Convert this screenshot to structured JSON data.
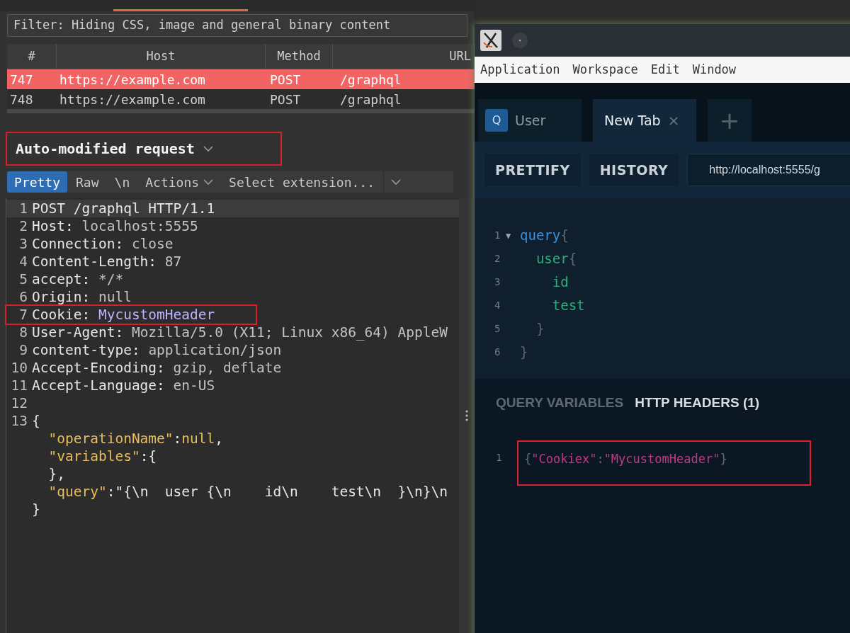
{
  "burp": {
    "filter": "Filter: Hiding CSS, image and general binary content",
    "table": {
      "columns": [
        "#",
        "Host",
        "Method",
        "URL"
      ],
      "rows": [
        {
          "cells": [
            "747",
            "https://example.com",
            "POST",
            "/graphql"
          ],
          "selected": true
        },
        {
          "cells": [
            "748",
            "https://example.com",
            "POST",
            "/graphql"
          ],
          "selected": false
        }
      ]
    },
    "request_title": "Auto-modified request",
    "request_title_highlighted": true,
    "toolbar": [
      {
        "label": "Pretty",
        "kind": "tab",
        "selected": true
      },
      {
        "label": "Raw",
        "kind": "tab",
        "selected": false
      },
      {
        "label": "\\n",
        "kind": "tab",
        "selected": false
      },
      {
        "label": "Actions",
        "kind": "menu",
        "selected": false
      },
      {
        "label": "Select extension...",
        "kind": "select",
        "selected": false
      }
    ],
    "editor": [
      {
        "number": "1",
        "current": true,
        "highlighted": false,
        "segments": [
          {
            "text": "POST /graphql HTTP/1.1",
            "kind": "name"
          }
        ]
      },
      {
        "number": "2",
        "current": false,
        "highlighted": false,
        "segments": [
          {
            "text": "Host: ",
            "kind": "name"
          },
          {
            "text": "localhost:5555",
            "kind": "value"
          }
        ]
      },
      {
        "number": "3",
        "current": false,
        "highlighted": false,
        "segments": [
          {
            "text": "Connection: ",
            "kind": "name"
          },
          {
            "text": "close",
            "kind": "value"
          }
        ]
      },
      {
        "number": "4",
        "current": false,
        "highlighted": false,
        "segments": [
          {
            "text": "Content-Length: ",
            "kind": "name"
          },
          {
            "text": "87",
            "kind": "value"
          }
        ]
      },
      {
        "number": "5",
        "current": false,
        "highlighted": false,
        "segments": [
          {
            "text": "accept: ",
            "kind": "name"
          },
          {
            "text": "*/*",
            "kind": "value"
          }
        ]
      },
      {
        "number": "6",
        "current": false,
        "highlighted": false,
        "segments": [
          {
            "text": "Origin: ",
            "kind": "name"
          },
          {
            "text": "null",
            "kind": "value"
          }
        ]
      },
      {
        "number": "7",
        "current": false,
        "highlighted": true,
        "segments": [
          {
            "text": "Cookie: ",
            "kind": "name"
          },
          {
            "text": "MycustomHeader",
            "kind": "custom"
          }
        ]
      },
      {
        "number": "8",
        "current": false,
        "highlighted": false,
        "segments": [
          {
            "text": "User-Agent: ",
            "kind": "name"
          },
          {
            "text": "Mozilla/5.0 (X11; Linux x86_64) AppleW",
            "kind": "value"
          }
        ]
      },
      {
        "number": "9",
        "current": false,
        "highlighted": false,
        "segments": [
          {
            "text": "content-type: ",
            "kind": "name"
          },
          {
            "text": "application/json",
            "kind": "value"
          }
        ]
      },
      {
        "number": "10",
        "current": false,
        "highlighted": false,
        "segments": [
          {
            "text": "Accept-Encoding: ",
            "kind": "name"
          },
          {
            "text": "gzip, deflate",
            "kind": "value"
          }
        ]
      },
      {
        "number": "11",
        "current": false,
        "highlighted": false,
        "segments": [
          {
            "text": "Accept-Language: ",
            "kind": "name"
          },
          {
            "text": "en-US",
            "kind": "value"
          }
        ]
      },
      {
        "number": "12",
        "current": false,
        "highlighted": false
      },
      {
        "number": "13",
        "current": false,
        "highlighted": false,
        "segments": [
          {
            "text": "{",
            "kind": "name"
          }
        ]
      },
      {
        "current": false,
        "highlighted": false,
        "segments": [
          {
            "text": "  \"operationName\"",
            "kind": "key"
          },
          {
            "text": ":",
            "kind": "name"
          },
          {
            "text": "null",
            "kind": "key"
          },
          {
            "text": ",",
            "kind": "name"
          }
        ]
      },
      {
        "current": false,
        "highlighted": false,
        "segments": [
          {
            "text": "  \"variables\"",
            "kind": "key"
          },
          {
            "text": ":{",
            "kind": "name"
          }
        ]
      },
      {
        "current": false,
        "highlighted": false,
        "segments": [
          {
            "text": "  },",
            "kind": "name"
          }
        ]
      },
      {
        "current": false,
        "highlighted": false,
        "segments": [
          {
            "text": "  \"query\"",
            "kind": "key"
          },
          {
            "text": ":\"{\\n  user {\\n    id\\n    test\\n  }\\n}\\n",
            "kind": "name"
          }
        ]
      },
      {
        "current": false,
        "highlighted": false,
        "segments": [
          {
            "text": "}",
            "kind": "name"
          }
        ]
      }
    ]
  },
  "altair": {
    "menu": [
      "Application",
      "Workspace",
      "Edit",
      "Window"
    ],
    "tabs": [
      {
        "label": "User",
        "badge": "Q",
        "selected": false
      },
      {
        "label": "New Tab",
        "close": "×",
        "selected": true
      }
    ],
    "add_tab": "+",
    "buttons": [
      "PRETTIFY",
      "HISTORY"
    ],
    "url": "http://localhost:5555/g",
    "query": [
      {
        "number": "1",
        "toggle": "▼",
        "segments": [
          {
            "text": "query",
            "kind": "keyword"
          },
          {
            "text": "{",
            "kind": "punct"
          }
        ]
      },
      {
        "number": "2",
        "segments": [
          {
            "text": "  user",
            "kind": "field"
          },
          {
            "text": "{",
            "kind": "punct"
          }
        ]
      },
      {
        "number": "3",
        "segments": [
          {
            "text": "    id",
            "kind": "field"
          }
        ]
      },
      {
        "number": "4",
        "segments": [
          {
            "text": "    test",
            "kind": "field"
          }
        ]
      },
      {
        "number": "5",
        "segments": [
          {
            "text": "  }",
            "kind": "punct"
          }
        ]
      },
      {
        "number": "6",
        "segments": [
          {
            "text": "}",
            "kind": "punct"
          }
        ]
      }
    ],
    "bottom_tabs": [
      {
        "label": "QUERY VARIABLES",
        "selected": false
      },
      {
        "label": "HTTP HEADERS (1)",
        "selected": true
      }
    ],
    "headers": [
      {
        "number": "1",
        "highlighted": true,
        "segments": [
          {
            "text": "{",
            "kind": "punct"
          },
          {
            "text": "\"Cookiex\"",
            "kind": "string"
          },
          {
            "text": ":",
            "kind": "punct"
          },
          {
            "text": "\"MycustomHeader\"",
            "kind": "string"
          },
          {
            "text": "}",
            "kind": "punct"
          }
        ]
      }
    ]
  }
}
